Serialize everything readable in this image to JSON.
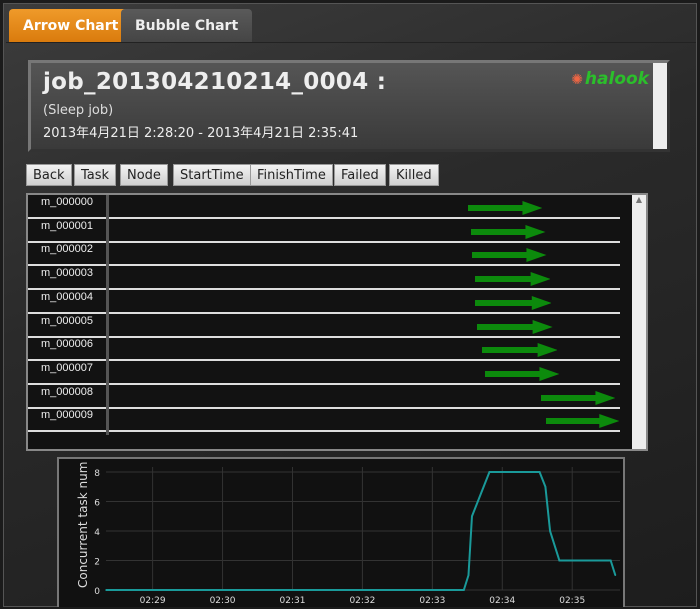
{
  "tabs": [
    {
      "label": "Arrow Chart",
      "active": true
    },
    {
      "label": "Bubble Chart",
      "active": false
    }
  ],
  "header": {
    "title": "job_201304210214_0004 :",
    "subtitle": "(Sleep job)",
    "time_range": "2013年4月21日 2:28:20 - 2013年4月21日 2:35:41",
    "logo": "halook"
  },
  "toolbar": [
    "Back",
    "Task",
    "Node",
    "StartTime",
    "FinishTime",
    "Failed",
    "Killed"
  ],
  "colors": {
    "accent": "#e08a1a",
    "arrow": "#0c8a0c",
    "line": "#1a9a9a"
  },
  "tasks": [
    {
      "name": "m_000000",
      "start": "02:33:30",
      "end": "02:34:34"
    },
    {
      "name": "m_000001",
      "start": "02:33:33",
      "end": "02:34:37"
    },
    {
      "name": "m_000002",
      "start": "02:33:34",
      "end": "02:34:38"
    },
    {
      "name": "m_000003",
      "start": "02:33:36",
      "end": "02:34:41"
    },
    {
      "name": "m_000004",
      "start": "02:33:36",
      "end": "02:34:42"
    },
    {
      "name": "m_000005",
      "start": "02:33:38",
      "end": "02:34:43"
    },
    {
      "name": "m_000006",
      "start": "02:33:42",
      "end": "02:34:47"
    },
    {
      "name": "m_000007",
      "start": "02:33:45",
      "end": "02:34:49"
    },
    {
      "name": "m_000008",
      "start": "02:34:33",
      "end": "02:35:37"
    },
    {
      "name": "m_000009",
      "start": "02:34:37",
      "end": "02:35:40"
    }
  ],
  "chart_data": {
    "type": "line",
    "ylabel": "Concurrent task num",
    "xlabel": "",
    "xlim": [
      "02:28:20",
      "02:35:41"
    ],
    "ylim": [
      0,
      8.6
    ],
    "grid": true,
    "xticks": [
      "02:29",
      "02:30",
      "02:31",
      "02:32",
      "02:33",
      "02:34",
      "02:35"
    ],
    "yticks": [
      0,
      2,
      4,
      6,
      8
    ],
    "points": [
      [
        "02:28:20",
        0
      ],
      [
        "02:33:27",
        0
      ],
      [
        "02:33:31",
        1
      ],
      [
        "02:33:34",
        5
      ],
      [
        "02:33:44",
        7
      ],
      [
        "02:33:49",
        8
      ],
      [
        "02:34:32",
        8
      ],
      [
        "02:34:37",
        7
      ],
      [
        "02:34:41",
        4
      ],
      [
        "02:34:49",
        2
      ],
      [
        "02:35:33",
        2
      ],
      [
        "02:35:37",
        1
      ]
    ]
  }
}
